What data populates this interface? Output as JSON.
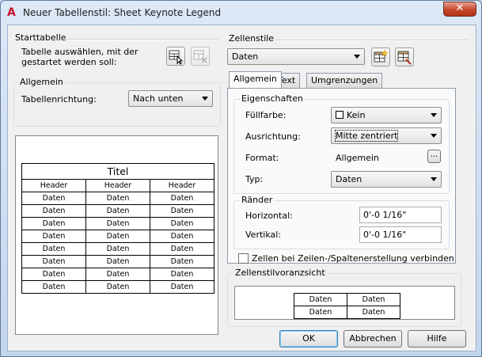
{
  "window": {
    "title": "Neuer Tabellenstil: Sheet Keynote Legend",
    "app_icon": "A",
    "close_glyph": "✕"
  },
  "start_table": {
    "group_title": "Starttabelle",
    "label_line1": "Tabelle auswählen, mit der",
    "label_line2": "gestartet werden soll:",
    "select_icon": "select-table-icon",
    "delete_icon": "delete-table-icon"
  },
  "general": {
    "group_title": "Allgemein",
    "direction_label": "Tabellenrichtung:",
    "direction_value": "Nach unten"
  },
  "preview_table": {
    "title": "Titel",
    "headers": [
      "Header",
      "Header",
      "Header"
    ],
    "rows": [
      [
        "Daten",
        "Daten",
        "Daten"
      ],
      [
        "Daten",
        "Daten",
        "Daten"
      ],
      [
        "Daten",
        "Daten",
        "Daten"
      ],
      [
        "Daten",
        "Daten",
        "Daten"
      ],
      [
        "Daten",
        "Daten",
        "Daten"
      ],
      [
        "Daten",
        "Daten",
        "Daten"
      ],
      [
        "Daten",
        "Daten",
        "Daten"
      ],
      [
        "Daten",
        "Daten",
        "Daten"
      ]
    ]
  },
  "cell_styles": {
    "group_title": "Zellenstile",
    "selected": "Daten",
    "new_icon": "new-cell-style-icon",
    "manage_icon": "manage-cell-styles-icon"
  },
  "tabs": [
    "Allgemein",
    "Text",
    "Umgrenzungen"
  ],
  "properties": {
    "group_title": "Eigenschaften",
    "fill_label": "Füllfarbe:",
    "fill_value": "Kein",
    "align_label": "Ausrichtung:",
    "align_value": "Mitte zentriert",
    "format_label": "Format:",
    "format_value": "Allgemein",
    "format_button": "...",
    "type_label": "Typ:",
    "type_value": "Daten"
  },
  "margins": {
    "group_title": "Ränder",
    "horizontal_label": "Horizontal:",
    "horizontal_value": "0'-0 1/16\"",
    "vertical_label": "Vertikal:",
    "vertical_value": "0'-0 1/16\""
  },
  "merge_checkbox": {
    "label": "Zellen bei Zeilen-/Spaltenerstellung verbinden",
    "checked": false
  },
  "cell_preview": {
    "group_title": "Zellenstilvoranzsicht",
    "cells": [
      [
        "Daten",
        "Daten"
      ],
      [
        "Daten",
        "Daten"
      ]
    ]
  },
  "buttons": {
    "ok": "OK",
    "cancel": "Abbrechen",
    "help": "Hilfe"
  }
}
